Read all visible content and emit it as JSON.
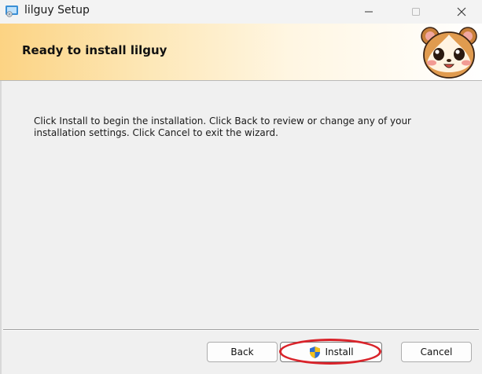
{
  "window": {
    "title": "lilguy Setup",
    "icon": "installer-icon",
    "controls": [
      "minimize-icon",
      "maximize-icon",
      "close-icon"
    ]
  },
  "banner": {
    "heading": "Ready to install lilguy",
    "image": "hamster-mascot",
    "gradient_color": "#fcd383"
  },
  "content": {
    "message": "Click Install to begin the installation. Click Back to review or change any of your installation settings. Click Cancel to exit the wizard."
  },
  "buttons": {
    "back_label": "Back",
    "install_label": "Install",
    "install_icon": "uac-shield-icon",
    "cancel_label": "Cancel"
  },
  "annotation": {
    "highlight_color": "#d9232a",
    "target": "install-button"
  }
}
